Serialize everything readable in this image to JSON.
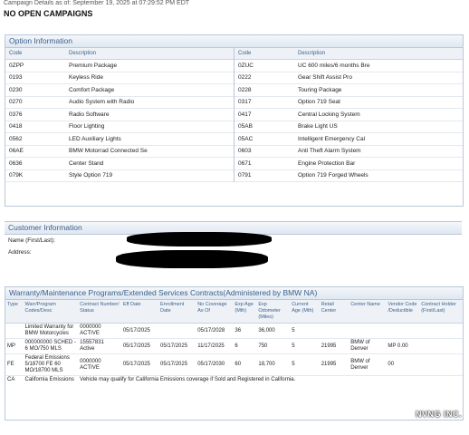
{
  "header": {
    "campaign_details": "Campaign Details as of: September 19, 2025 at 07:29:52 PM EDT",
    "no_open": "NO OPEN CAMPAIGNS"
  },
  "option_info": {
    "title": "Option Information",
    "col_code": "Code",
    "col_desc": "Description",
    "left": [
      {
        "code": "0ZPP",
        "desc": "Premium Package"
      },
      {
        "code": "0193",
        "desc": "Keyless Ride"
      },
      {
        "code": "0230",
        "desc": "Comfort Package"
      },
      {
        "code": "0270",
        "desc": "Audio System with Radio"
      },
      {
        "code": "0376",
        "desc": "Radio Software"
      },
      {
        "code": "0418",
        "desc": "Floor Lighting"
      },
      {
        "code": "0562",
        "desc": "LED Auxiliary Lights"
      },
      {
        "code": "06AE",
        "desc": "BMW Motorrad Connected Se"
      },
      {
        "code": "0636",
        "desc": "Center Stand"
      },
      {
        "code": "079K",
        "desc": "Style Option 719"
      }
    ],
    "right": [
      {
        "code": "0ZUC",
        "desc": "UC 600 miles/6 months Bre"
      },
      {
        "code": "0222",
        "desc": "Gear Shift Assist Pro"
      },
      {
        "code": "0228",
        "desc": "Touring Package"
      },
      {
        "code": "0317",
        "desc": "Option 719 Seat"
      },
      {
        "code": "0417",
        "desc": "Central Locking System"
      },
      {
        "code": "05AB",
        "desc": "Brake Light US"
      },
      {
        "code": "05AC",
        "desc": "Intelligent Emergency Cal"
      },
      {
        "code": "0603",
        "desc": "Anti Theft Alarm System"
      },
      {
        "code": "0671",
        "desc": "Engine Protection Bar"
      },
      {
        "code": "0791",
        "desc": "Option 719 Forged Wheels"
      }
    ]
  },
  "customer": {
    "title": "Customer Information",
    "name_label": "Name (First/Last):",
    "address_label": "Address:"
  },
  "warranty": {
    "title": "Warranty/Maintenance Programs/Extended Services Contracts(Administered by BMW NA)",
    "headers": [
      "Type",
      "Warr/Program Codes/Desc",
      "Contract Number/ Status",
      "Eff Date",
      "Enrollment Date",
      "No Coverage As Of",
      "Exp Age (Mth)",
      "Exp Odometer (Miles)",
      "Current Age (Mth)",
      "Retail Center",
      "Center Name",
      "Vendor Code /Deductible",
      "Contract Holder (First/Last)"
    ],
    "rows": [
      {
        "type": "",
        "desc": "Limited Warranty for BMW Motorcycles",
        "contract": "0000000 ACTIVE",
        "eff": "05/17/2025",
        "enroll": "",
        "nocov": "05/17/2028",
        "expage": "36",
        "expodo": "36,000",
        "curage": "5",
        "retail": "",
        "center": "",
        "vendor": "",
        "holder": ""
      },
      {
        "type": "MP",
        "desc": "000000000 SCHED - 6 MO/750 MLS",
        "contract": "15557831 Active",
        "eff": "05/17/2025",
        "enroll": "05/17/2025",
        "nocov": "11/17/2025",
        "expage": "6",
        "expodo": "750",
        "curage": "5",
        "retail": "21995",
        "center": "BMW of Denver",
        "vendor": "MP 0.00",
        "holder": ""
      },
      {
        "type": "FE",
        "desc": "Federal Emissions 5/18700 FE 60 MO/18700 MLS",
        "contract": "0000000 ACTIVE",
        "eff": "05/17/2025",
        "enroll": "05/17/2025",
        "nocov": "05/17/2030",
        "expage": "60",
        "expodo": "18,700",
        "curage": "5",
        "retail": "21995",
        "center": "BMW of Denver",
        "vendor": "00",
        "holder": ""
      }
    ],
    "ca": {
      "type": "CA",
      "desc": "California Emissions",
      "note": "Vehicle may qualify for California Emissions coverage if Sold and Registered in California."
    }
  },
  "watermark": "NVNG INC.",
  "colors": {
    "accent": "#3b5f8a",
    "border": "#b9c7d8",
    "red": "#cc0000"
  }
}
